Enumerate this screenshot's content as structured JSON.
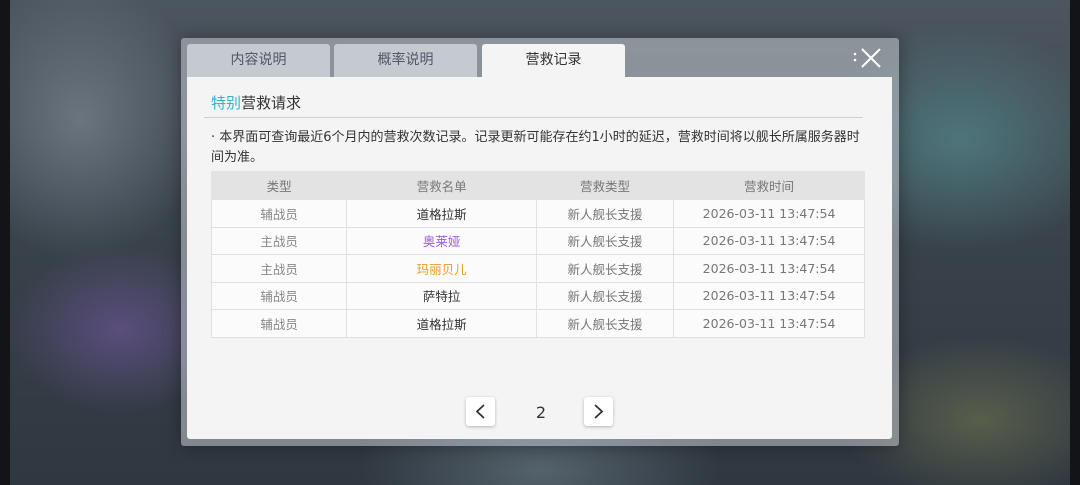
{
  "tabs": [
    {
      "label": "内容说明",
      "active": false
    },
    {
      "label": "概率说明",
      "active": false
    },
    {
      "label": "营救记录",
      "active": true
    }
  ],
  "section": {
    "title_highlight": "特别",
    "title_rest": "营救请求"
  },
  "notice": "· 本界面可查询最近6个月内的营救次数记录。记录更新可能存在约1小时的延迟，营救时间将以舰长所属服务器时间为准。",
  "table": {
    "headers": [
      "类型",
      "营救名单",
      "营救类型",
      "营救时间"
    ],
    "rows": [
      {
        "type": "辅战员",
        "name": "道格拉斯",
        "rescue_type": "新人舰长支援",
        "time": "2026-03-11 13:47:54",
        "name_color": "#333333"
      },
      {
        "type": "主战员",
        "name": "奥莱娅",
        "rescue_type": "新人舰长支援",
        "time": "2026-03-11 13:47:54",
        "name_color": "#9b5bd6"
      },
      {
        "type": "主战员",
        "name": "玛丽贝儿",
        "rescue_type": "新人舰长支援",
        "time": "2026-03-11 13:47:54",
        "name_color": "#eb9a2a"
      },
      {
        "type": "辅战员",
        "name": "萨特拉",
        "rescue_type": "新人舰长支援",
        "time": "2026-03-11 13:47:54",
        "name_color": "#333333"
      },
      {
        "type": "辅战员",
        "name": "道格拉斯",
        "rescue_type": "新人舰长支援",
        "time": "2026-03-11 13:47:54",
        "name_color": "#333333"
      }
    ]
  },
  "pagination": {
    "current_page": "2"
  },
  "icons": {
    "close": "close-icon",
    "prev": "chevron-left-icon",
    "next": "chevron-right-icon"
  },
  "colors": {
    "accent": "#34b3c4"
  }
}
